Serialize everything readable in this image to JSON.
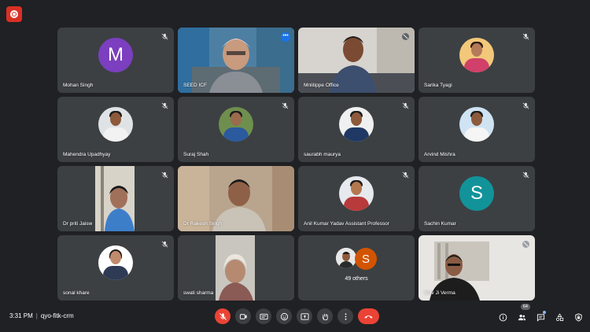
{
  "recording_indicator": "recording-icon",
  "participants": [
    {
      "name": "Mohan Singh",
      "type": "initial",
      "initial": "M",
      "color": "#7b3fbf"
    },
    {
      "name": "SEED ICF",
      "type": "video",
      "active": true,
      "more": "•••"
    },
    {
      "name": "Mnlitippe Office",
      "type": "video"
    },
    {
      "name": "Sarika Tyagi",
      "type": "photo"
    },
    {
      "name": "Mahendra Upadhyay",
      "type": "photo"
    },
    {
      "name": "Suraj Shah",
      "type": "photo"
    },
    {
      "name": "saurabh maurya",
      "type": "photo"
    },
    {
      "name": "Arvind Mishra",
      "type": "photo"
    },
    {
      "name": "Dr priti Jaisw",
      "type": "video"
    },
    {
      "name": "Dr Rakesh Singh",
      "type": "video"
    },
    {
      "name": "Anil Kumar Yadav Assistant Professor",
      "type": "photo"
    },
    {
      "name": "Sachin Kumar",
      "type": "initial",
      "initial": "S",
      "color": "#12939a"
    },
    {
      "name": "sonal khare",
      "type": "photo"
    },
    {
      "name": "swati sharma",
      "type": "video"
    },
    {
      "name": "",
      "type": "others",
      "initial": "S",
      "label": "49 others"
    },
    {
      "name": "Shiv Ji Verma",
      "type": "video"
    }
  ],
  "meeting": {
    "time": "3:31 PM",
    "separator": "|",
    "code": "qyo-fitk-crm"
  },
  "controls": [
    "mic-off-icon",
    "camera-icon",
    "captions-icon",
    "emoji-icon",
    "present-icon",
    "raise-hand-icon",
    "more-options-icon",
    "end-call-icon"
  ],
  "right_controls": {
    "info": "info-icon",
    "people": "people-icon",
    "people_count": "64",
    "chat": "chat-icon",
    "activities": "activities-icon",
    "host_controls": "host-controls-icon"
  },
  "colors": {
    "background": "#202124",
    "tile": "#3c4043",
    "active": "#8ab4f8",
    "red": "#ea4335"
  }
}
